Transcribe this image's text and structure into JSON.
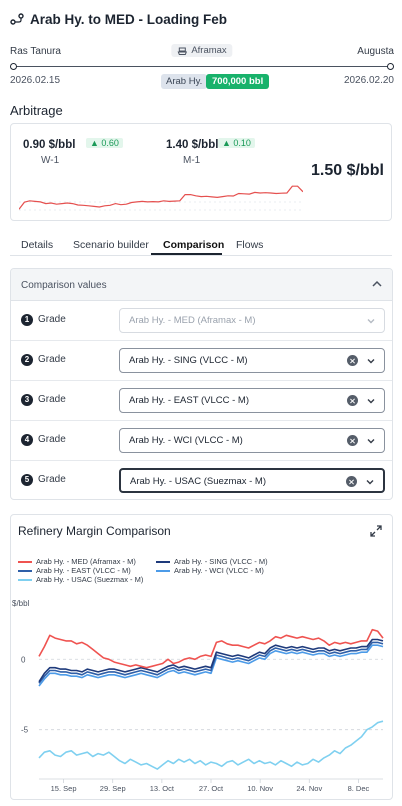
{
  "header": {
    "title": "Arab Hy. to MED - Loading Feb",
    "icon": "route-icon"
  },
  "route": {
    "from_port": "Ras Tanura",
    "to_port": "Augusta",
    "vessel": "Aframax",
    "from_date": "2026.02.15",
    "to_date": "2026.02.20",
    "grade": "Arab Hy.",
    "volume": "700,000 bbl"
  },
  "arbitrage": {
    "title": "Arbitrage",
    "w1": {
      "value": "0.90 $/bbl",
      "change": "0.60",
      "label": "W-1"
    },
    "m1": {
      "value": "1.40 $/bbl",
      "change": "0.10",
      "label": "M-1"
    },
    "current": "1.50 $/bbl",
    "spark_color": "#e5504f",
    "spark_values": [
      0.1,
      0.35,
      0.4,
      0.38,
      0.36,
      0.3,
      0.32,
      0.28,
      0.3,
      0.32,
      0.3,
      0.25,
      0.24,
      0.22,
      0.2,
      0.18,
      0.22,
      0.24,
      0.3,
      0.26,
      0.28,
      0.34,
      0.36,
      0.38,
      0.36,
      0.37,
      0.36,
      0.4,
      0.38,
      0.39,
      0.4,
      0.62,
      0.62,
      0.58,
      0.55,
      0.56,
      0.54,
      0.52,
      0.55,
      0.58,
      0.57,
      0.66,
      0.65,
      0.64,
      0.7,
      0.68,
      0.69,
      0.68,
      0.66,
      0.67,
      0.68,
      0.92,
      0.92,
      0.72
    ]
  },
  "tabs": {
    "items": [
      {
        "label": "Details",
        "active": false
      },
      {
        "label": "Scenario builder",
        "active": false
      },
      {
        "label": "Comparison",
        "active": true
      },
      {
        "label": "Flows",
        "active": false
      }
    ]
  },
  "comparison": {
    "section_label": "Comparison values",
    "rows": [
      {
        "index": "1",
        "label": "Grade",
        "value": "Arab Hy. - MED (Aframax - M)",
        "state": "disabled"
      },
      {
        "index": "2",
        "label": "Grade",
        "value": "Arab Hy. - SING (VLCC - M)",
        "state": "normal"
      },
      {
        "index": "3",
        "label": "Grade",
        "value": "Arab Hy. - EAST (VLCC - M)",
        "state": "normal"
      },
      {
        "index": "4",
        "label": "Grade",
        "value": "Arab Hy. - WCI (VLCC - M)",
        "state": "normal"
      },
      {
        "index": "5",
        "label": "Grade",
        "value": "Arab Hy. - USAC (Suezmax - M)",
        "state": "focused"
      }
    ]
  },
  "chart_data": {
    "type": "line",
    "title": "Refinery Margin Comparison",
    "ylabel": "$/bbl",
    "ylim": [
      -8.5,
      3
    ],
    "yticks": [
      0,
      -5
    ],
    "xlabels": [
      "15. Sep",
      "29. Sep",
      "13. Oct",
      "27. Oct",
      "10. Nov",
      "24. Nov",
      "8. Dec"
    ],
    "n_points": 65,
    "grid": "horizontal-dashed",
    "legend_position": "top",
    "series": [
      {
        "name": "Arab Hy. - MED (Aframax - M)",
        "color": "#ef5350",
        "values": [
          0.2,
          0.9,
          1.7,
          1.5,
          1.4,
          1.3,
          1.3,
          1.1,
          1.2,
          1.0,
          0.7,
          0.4,
          0.1,
          0.0,
          -0.2,
          -0.3,
          -0.4,
          -0.5,
          -0.4,
          -0.5,
          -0.6,
          -0.5,
          -0.4,
          -0.3,
          0.0,
          -0.3,
          -0.2,
          0.0,
          0.1,
          0.0,
          0.2,
          0.3,
          0.2,
          1.2,
          1.3,
          1.1,
          1.0,
          1.0,
          0.9,
          0.8,
          1.0,
          1.2,
          1.1,
          1.3,
          1.6,
          1.5,
          1.7,
          1.6,
          1.5,
          1.6,
          1.5,
          1.4,
          1.5,
          1.3,
          1.0,
          1.2,
          1.1,
          1.2,
          1.1,
          1.2,
          1.3,
          1.3,
          2.1,
          2.0,
          1.5
        ]
      },
      {
        "name": "Arab Hy. - SING (VLCC - M)",
        "color": "#1e3a7b",
        "values": [
          -1.6,
          -1.0,
          -0.6,
          -0.6,
          -0.7,
          -0.7,
          -0.8,
          -0.8,
          -0.9,
          -0.7,
          -0.8,
          -0.9,
          -0.8,
          -0.7,
          -0.7,
          -0.8,
          -0.9,
          -0.8,
          -0.7,
          -0.6,
          -0.7,
          -0.8,
          -0.9,
          -0.7,
          -0.5,
          -0.4,
          -0.6,
          -0.5,
          -0.6,
          -0.7,
          -0.6,
          -0.5,
          -0.6,
          0.5,
          0.4,
          0.3,
          0.2,
          0.3,
          0.2,
          0.1,
          0.3,
          0.5,
          0.4,
          0.8,
          1.0,
          0.9,
          0.8,
          0.9,
          0.8,
          0.9,
          0.8,
          0.7,
          0.8,
          0.8,
          0.6,
          0.7,
          0.6,
          0.7,
          0.8,
          0.8,
          0.9,
          0.9,
          1.4,
          1.4,
          1.3
        ]
      },
      {
        "name": "Arab Hy. - EAST (VLCC - M)",
        "color": "#2f5fa8",
        "values": [
          -1.7,
          -1.2,
          -0.8,
          -0.8,
          -0.9,
          -0.9,
          -1.0,
          -1.0,
          -1.1,
          -0.9,
          -1.0,
          -1.1,
          -1.0,
          -0.9,
          -0.9,
          -1.0,
          -1.1,
          -1.0,
          -0.9,
          -0.8,
          -0.9,
          -1.0,
          -1.1,
          -0.9,
          -0.7,
          -0.6,
          -0.8,
          -0.7,
          -0.8,
          -0.9,
          -0.8,
          -0.7,
          -0.8,
          0.3,
          0.2,
          0.1,
          0.0,
          0.1,
          0.0,
          -0.1,
          0.1,
          0.3,
          0.2,
          0.6,
          0.8,
          0.7,
          0.6,
          0.7,
          0.6,
          0.7,
          0.6,
          0.5,
          0.6,
          0.6,
          0.4,
          0.5,
          0.4,
          0.5,
          0.6,
          0.6,
          0.7,
          0.7,
          1.2,
          1.2,
          1.1
        ]
      },
      {
        "name": "Arab Hy. - WCI (VLCC - M)",
        "color": "#4c9be8",
        "values": [
          -1.9,
          -1.4,
          -1.0,
          -1.0,
          -1.1,
          -1.1,
          -1.2,
          -1.2,
          -1.3,
          -1.1,
          -1.2,
          -1.3,
          -1.2,
          -1.1,
          -1.1,
          -1.2,
          -1.3,
          -1.2,
          -1.1,
          -1.0,
          -1.1,
          -1.2,
          -1.3,
          -1.1,
          -0.9,
          -0.8,
          -1.0,
          -0.9,
          -1.0,
          -1.1,
          -1.0,
          -0.9,
          -1.0,
          0.1,
          0.0,
          -0.1,
          -0.2,
          -0.1,
          -0.2,
          -0.3,
          -0.1,
          0.1,
          0.0,
          0.4,
          0.6,
          0.5,
          0.4,
          0.5,
          0.4,
          0.5,
          0.4,
          0.3,
          0.4,
          0.4,
          0.2,
          0.3,
          0.2,
          0.3,
          0.4,
          0.4,
          0.5,
          0.5,
          1.0,
          1.0,
          0.9
        ]
      },
      {
        "name": "Arab Hy. - USAC (Suezmax - M)",
        "color": "#7fd0f0",
        "values": [
          -7.0,
          -6.6,
          -6.5,
          -6.8,
          -6.9,
          -6.6,
          -6.5,
          -6.8,
          -6.7,
          -6.6,
          -6.9,
          -6.7,
          -6.8,
          -6.6,
          -6.9,
          -7.2,
          -7.4,
          -7.1,
          -7.3,
          -7.5,
          -7.4,
          -7.6,
          -7.8,
          -7.5,
          -7.2,
          -7.4,
          -7.1,
          -7.3,
          -7.1,
          -7.4,
          -7.2,
          -7.5,
          -7.3,
          -7.4,
          -7.6,
          -7.3,
          -7.2,
          -7.5,
          -7.3,
          -7.1,
          -7.4,
          -7.2,
          -7.4,
          -7.3,
          -7.5,
          -7.2,
          -7.4,
          -7.6,
          -7.3,
          -7.5,
          -7.4,
          -7.1,
          -7.3,
          -7.0,
          -6.8,
          -6.5,
          -6.7,
          -6.3,
          -6.1,
          -5.8,
          -5.5,
          -5.0,
          -4.8,
          -4.5,
          -4.4
        ]
      }
    ]
  }
}
